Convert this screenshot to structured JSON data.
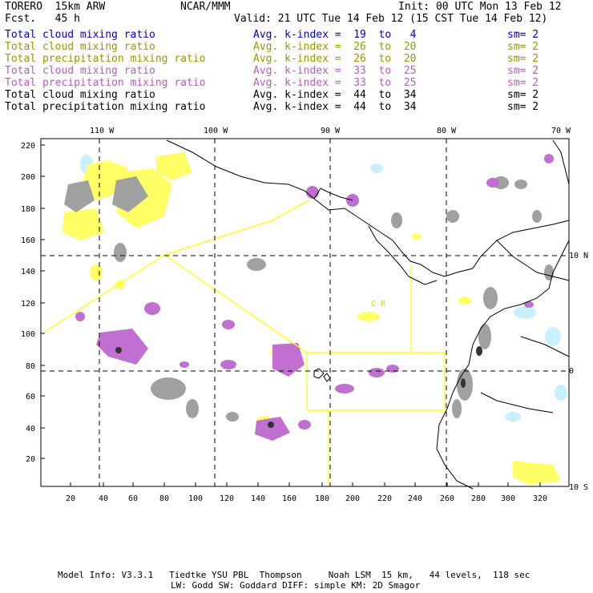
{
  "header": {
    "model": "TORERO  15km ARW",
    "forecast": "Fcst.   45 h",
    "center": "NCAR/MMM",
    "init": "Init: 00 UTC Mon 13 Feb 12",
    "valid": "Valid: 21 UTC Tue 14 Feb 12 (15 CST Tue 14 Feb 12)"
  },
  "legend": [
    {
      "field": "Total cloud mixing ratio",
      "index": "Avg. k-index =  19  to   4",
      "sm": "sm= 2",
      "color": "#0000cc"
    },
    {
      "field": "Total cloud mixing ratio",
      "index": "Avg. k-index =  26  to  20",
      "sm": "sm= 2",
      "color": "#999900"
    },
    {
      "field": "Total precipitation mixing ratio",
      "index": "Avg. k-index =  26  to  20",
      "sm": "sm= 2",
      "color": "#999900"
    },
    {
      "field": "Total cloud mixing ratio",
      "index": "Avg. k-index =  33  to  25",
      "sm": "sm= 2",
      "color": "#b060c0"
    },
    {
      "field": "Total precipitation mixing ratio",
      "index": "Avg. k-index =  33  to  25",
      "sm": "sm= 2",
      "color": "#b060c0"
    },
    {
      "field": "Total cloud mixing ratio",
      "index": "Avg. k-index =  44  to  34",
      "sm": "sm= 2",
      "color": "#000000"
    },
    {
      "field": "Total precipitation mixing ratio",
      "index": "Avg. k-index =  44  to  34",
      "sm": "sm= 2",
      "color": "#000000"
    }
  ],
  "map": {
    "top_lon_labels": [
      "110 W",
      "100 W",
      "90 W",
      "80 W",
      "70 W"
    ],
    "right_lat_labels": [
      "10 N",
      "0",
      "10 S"
    ],
    "y_ticks": [
      "220",
      "200",
      "180",
      "160",
      "140",
      "120",
      "100",
      "80",
      "60",
      "40",
      "20"
    ],
    "x_ticks": [
      "20",
      "40",
      "60",
      "80",
      "100",
      "120",
      "140",
      "160",
      "180",
      "200",
      "220",
      "240",
      "260",
      "280",
      "300",
      "320"
    ],
    "region_label": "C  R",
    "colors": {
      "yellow": "#ffff66",
      "purple": "#c070d0",
      "gray": "#a0a0a0",
      "cyan": "#c8f0ff",
      "boundary": "#ffff00",
      "coast": "#000000"
    }
  },
  "footer": {
    "line1": "Model Info: V3.3.1   Tiedtke YSU PBL  Thompson     Noah LSM  15 km,   44 levels,  118 sec",
    "line2": "LW: Godd SW: Goddard DIFF: simple KM: 2D Smagor"
  }
}
